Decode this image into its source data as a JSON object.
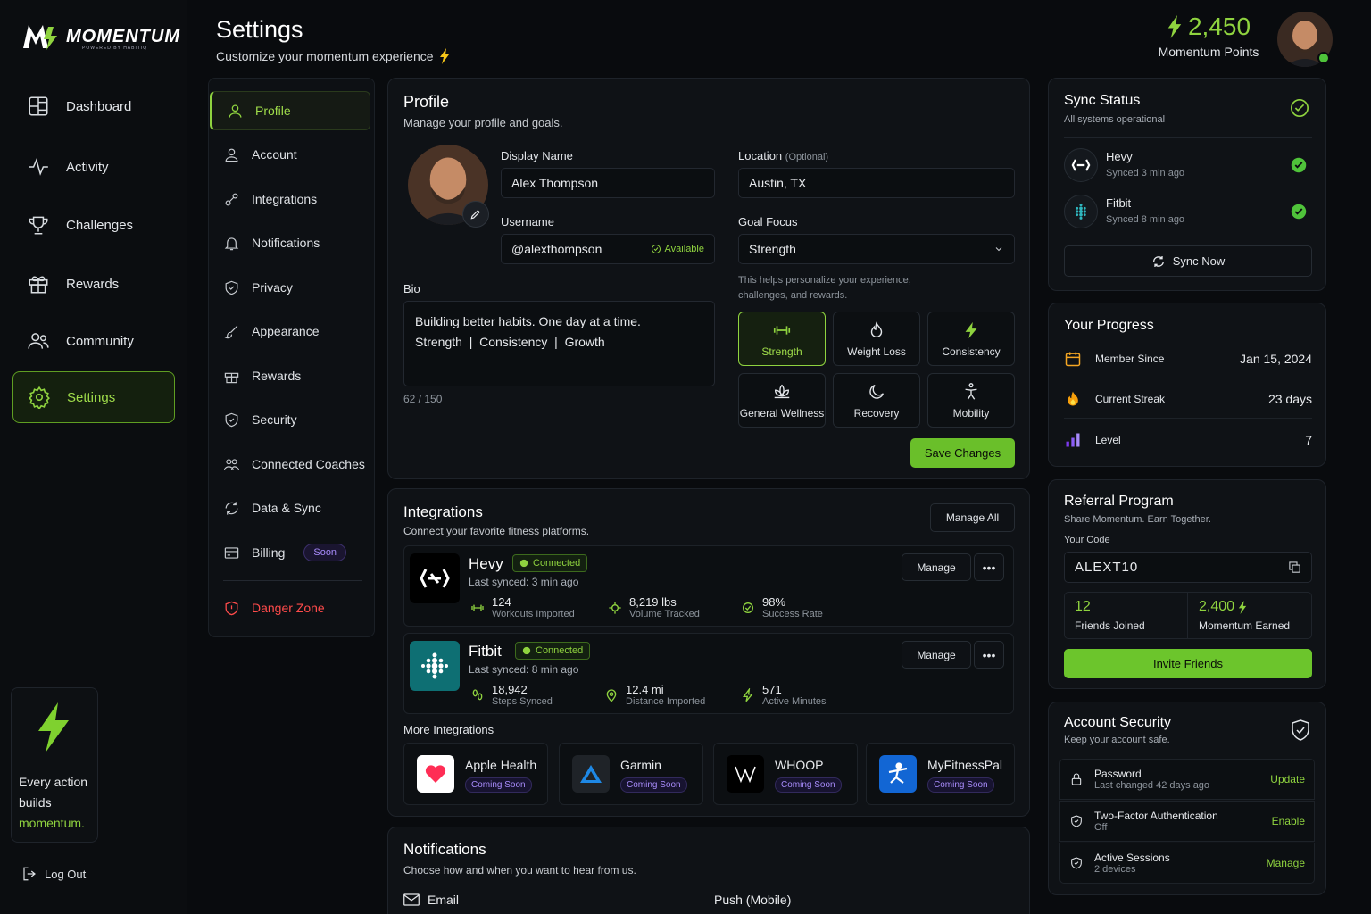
{
  "brand": {
    "name": "MOMENTUM",
    "tagline": "POWERED BY HABITIQ",
    "accent": "#8fd33f"
  },
  "nav": [
    {
      "label": "Dashboard",
      "icon": "dashboard-icon"
    },
    {
      "label": "Activity",
      "icon": "activity-icon"
    },
    {
      "label": "Challenges",
      "icon": "trophy-icon"
    },
    {
      "label": "Rewards",
      "icon": "gift-icon"
    },
    {
      "label": "Community",
      "icon": "users-icon"
    },
    {
      "label": "Settings",
      "icon": "gear-icon",
      "active": true
    }
  ],
  "promo": {
    "line1": "Every action",
    "line2": "builds",
    "highlight": "momentum."
  },
  "logout": "Log Out",
  "header": {
    "title": "Settings",
    "subtitle": "Customize your momentum experience",
    "points": "2,450",
    "points_label": "Momentum Points"
  },
  "settings_menu": [
    {
      "label": "Profile",
      "active": true
    },
    {
      "label": "Account"
    },
    {
      "label": "Integrations"
    },
    {
      "label": "Notifications"
    },
    {
      "label": "Privacy"
    },
    {
      "label": "Appearance"
    },
    {
      "label": "Rewards"
    },
    {
      "label": "Security"
    },
    {
      "label": "Connected Coaches"
    },
    {
      "label": "Data & Sync"
    },
    {
      "label": "Billing",
      "badge": "Soon"
    },
    {
      "label": "Danger Zone",
      "danger": true
    }
  ],
  "profile": {
    "title": "Profile",
    "subtitle": "Manage your profile and goals.",
    "display_name_label": "Display Name",
    "display_name": "Alex Thompson",
    "username_label": "Username",
    "username": "@alexthompson",
    "username_status": "Available",
    "location_label": "Location",
    "location_optional": "(Optional)",
    "location": "Austin, TX",
    "goal_label": "Goal Focus",
    "goal": "Strength",
    "goal_help": "This helps personalize your experience,",
    "goal_help2": "challenges, and rewards.",
    "bio_label": "Bio",
    "bio_line1": "Building better habits. One day at a time.",
    "bio_line2": "Strength  |  Consistency  |  Growth",
    "bio_count": "62 / 150",
    "goals": [
      "Strength",
      "Weight Loss",
      "Consistency",
      "General Wellness",
      "Recovery",
      "Mobility"
    ],
    "save": "Save Changes"
  },
  "integrations": {
    "title": "Integrations",
    "subtitle": "Connect your favorite fitness platforms.",
    "manage_all": "Manage All",
    "items": [
      {
        "name": "Hevy",
        "status": "Connected",
        "synced": "Last synced: 3 min ago",
        "manage": "Manage",
        "stats": [
          {
            "v": "124",
            "l": "Workouts Imported"
          },
          {
            "v": "8,219 lbs",
            "l": "Volume Tracked"
          },
          {
            "v": "98%",
            "l": "Success Rate"
          }
        ]
      },
      {
        "name": "Fitbit",
        "status": "Connected",
        "synced": "Last synced: 8 min ago",
        "manage": "Manage",
        "stats": [
          {
            "v": "18,942",
            "l": "Steps Synced"
          },
          {
            "v": "12.4 mi",
            "l": "Distance Imported"
          },
          {
            "v": "571",
            "l": "Active Minutes"
          }
        ]
      }
    ],
    "more_label": "More Integrations",
    "more": [
      {
        "name": "Apple Health",
        "badge": "Coming Soon"
      },
      {
        "name": "Garmin",
        "badge": "Coming Soon"
      },
      {
        "name": "WHOOP",
        "badge": "Coming Soon"
      },
      {
        "name": "MyFitnessPal",
        "badge": "Coming Soon"
      }
    ]
  },
  "notifications": {
    "title": "Notifications",
    "subtitle": "Choose how and when you want to hear from us.",
    "email": "Email",
    "push": "Push (Mobile)"
  },
  "sync": {
    "title": "Sync Status",
    "subtitle": "All systems operational",
    "items": [
      {
        "name": "Hevy",
        "time": "Synced 3 min ago"
      },
      {
        "name": "Fitbit",
        "time": "Synced 8 min ago"
      }
    ],
    "button": "Sync Now"
  },
  "progress": {
    "title": "Your Progress",
    "rows": [
      {
        "label": "Member Since",
        "value": "Jan 15, 2024"
      },
      {
        "label": "Current Streak",
        "value": "23 days"
      },
      {
        "label": "Level",
        "value": "7"
      }
    ]
  },
  "referral": {
    "title": "Referral Program",
    "subtitle": "Share Momentum. Earn Together.",
    "code_label": "Your Code",
    "code": "ALEXT10",
    "friends": "12",
    "friends_label": "Friends Joined",
    "earned": "2,400",
    "earned_label": "Momentum Earned",
    "button": "Invite Friends"
  },
  "security": {
    "title": "Account Security",
    "subtitle": "Keep your account safe.",
    "rows": [
      {
        "title": "Password",
        "sub": "Last changed 42 days ago",
        "action": "Update"
      },
      {
        "title": "Two-Factor Authentication",
        "sub": "Off",
        "action": "Enable"
      },
      {
        "title": "Active Sessions",
        "sub": "2 devices",
        "action": "Manage"
      }
    ]
  }
}
